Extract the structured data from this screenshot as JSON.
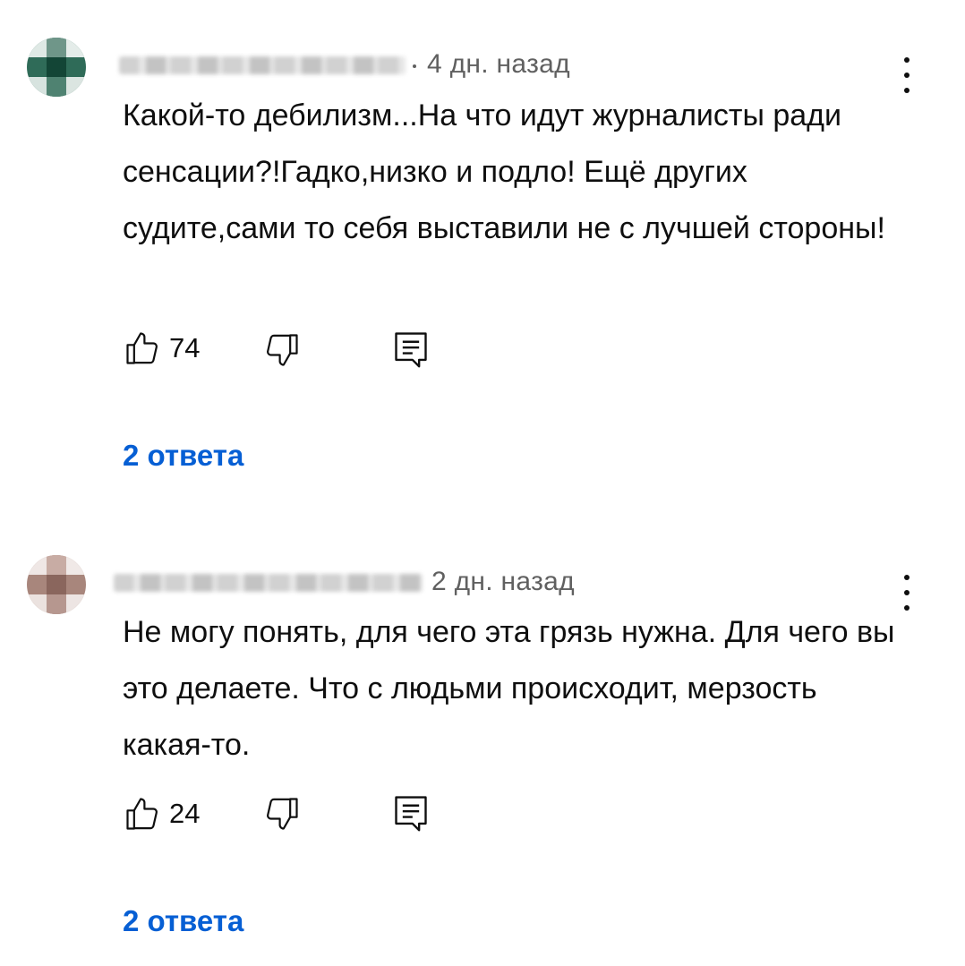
{
  "comments": [
    {
      "time": "4 дн. назад",
      "text": "Какой-то дебилизм...На что идут журналисты ради сенсации?!Гадко,низко и подло! Ещё других судите,сами то себя выставили не с лучшей стороны!",
      "likes": "74",
      "replies": "2 ответа",
      "avatar_color": "#1f5c4a"
    },
    {
      "time": "2 дн. назад",
      "text": "Не могу понять, для чего эта грязь нужна. Для чего вы это делаете. Что с людьми происходит, мерзость какая-то.",
      "likes": "24",
      "replies": "2 ответа",
      "avatar_color": "#9a7b72"
    }
  ],
  "icons": {
    "like": "thumbs-up-icon",
    "dislike": "thumbs-down-icon",
    "reply": "reply-comment-icon",
    "more": "more-vert-icon"
  },
  "colors": {
    "link": "#065fd4",
    "meta": "#606060",
    "text": "#0f0f0f"
  }
}
